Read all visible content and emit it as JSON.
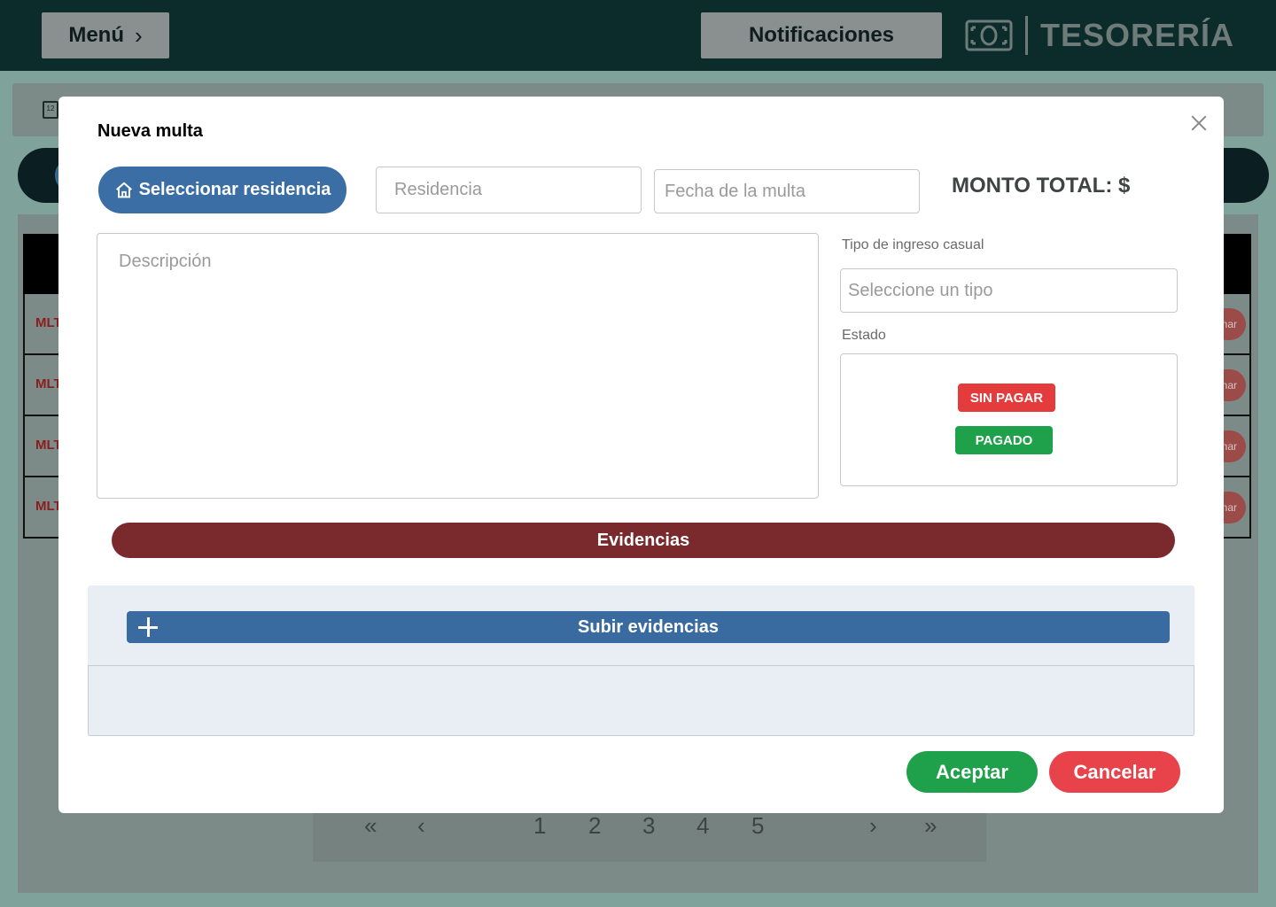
{
  "topbar": {
    "menu_label": "Menú",
    "menu_chevron": "›",
    "notifications_label": "Notificaciones",
    "brand_icon": "money-icon",
    "brand_title": "TESORERÍA"
  },
  "background": {
    "calendar_day": "12",
    "rows": [
      {
        "code": "MLT",
        "action": "nar"
      },
      {
        "code": "MLT",
        "action": "nar"
      },
      {
        "code": "MLT",
        "action": "nar"
      },
      {
        "code": "MLT",
        "action": "nar"
      }
    ],
    "pager": {
      "first": "«",
      "prev": "‹",
      "pages": [
        "1",
        "2",
        "3",
        "4",
        "5"
      ],
      "next": "›",
      "last": "»"
    }
  },
  "modal": {
    "title": "Nueva multa",
    "select_residence_label": "Seleccionar residencia",
    "residence_placeholder": "Residencia",
    "date_placeholder": "Fecha de la multa",
    "total_label": "MONTO TOTAL: $",
    "description_placeholder": "Descripción",
    "tipo_label": "Tipo de ingreso casual",
    "tipo_placeholder": "Seleccione un tipo",
    "estado_label": "Estado",
    "estado_options": [
      "SIN PAGAR",
      "PAGADO"
    ],
    "evidencias_label": "Evidencias",
    "upload_label": "Subir evidencias",
    "accept_label": "Aceptar",
    "cancel_label": "Cancelar"
  },
  "colors": {
    "topbar": "#0b2c2a",
    "primary_blue": "#3b6ea5",
    "evidencias_maroon": "#7a2a2c",
    "success_green": "#1fa04a",
    "danger_red": "#e43c3c"
  }
}
